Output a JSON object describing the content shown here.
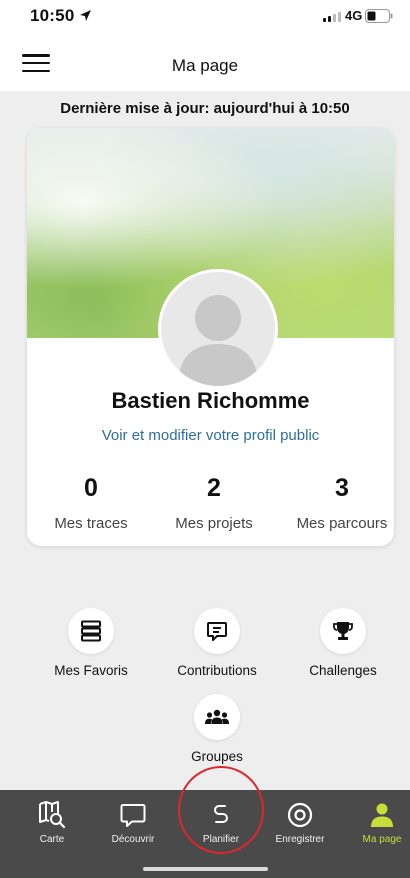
{
  "status_bar": {
    "time": "10:50",
    "network": "4G"
  },
  "header": {
    "title": "Ma page"
  },
  "update_line": "Dernière mise à jour: aujourd'hui à 10:50",
  "profile": {
    "name": "Bastien Richomme",
    "link": "Voir et modifier votre profil public",
    "stats": [
      {
        "value": "0",
        "label": "Mes traces"
      },
      {
        "value": "2",
        "label": "Mes projets"
      },
      {
        "value": "3",
        "label": "Mes parcours"
      }
    ]
  },
  "shortcuts": [
    {
      "label": "Mes Favoris",
      "icon": "favorites-list-icon"
    },
    {
      "label": "Contributions",
      "icon": "chat-bubble-icon"
    },
    {
      "label": "Challenges",
      "icon": "trophy-icon"
    },
    {
      "label": "Groupes",
      "icon": "group-icon"
    }
  ],
  "bottom_nav": {
    "items": [
      {
        "label": "Carte",
        "icon": "map-search-icon"
      },
      {
        "label": "Découvrir",
        "icon": "speech-bubble-icon"
      },
      {
        "label": "Planifier",
        "icon": "route-icon"
      },
      {
        "label": "Enregistrer",
        "icon": "record-icon"
      },
      {
        "label": "Ma page",
        "icon": "person-icon"
      }
    ],
    "active_index": 4
  },
  "colors": {
    "accent": "#c6dd3a",
    "link": "#2c6ea3",
    "nav_background": "#4a4a4a",
    "highlight": "#e0262b"
  }
}
